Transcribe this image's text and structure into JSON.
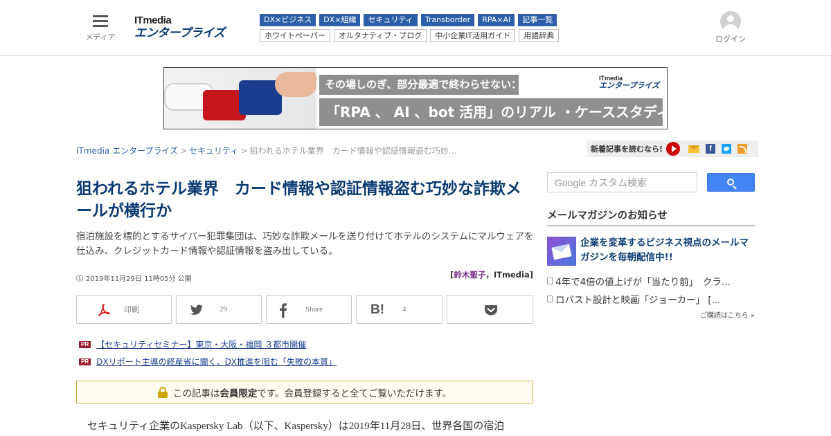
{
  "header": {
    "menu_label": "メディア",
    "logo_it": "ITmedia",
    "logo_name": "エンタープライズ",
    "tags_primary": [
      "DX×ビジネス",
      "DX×組織",
      "セキュリティ",
      "Transborder",
      "RPA×AI",
      "記事一覧"
    ],
    "tags_secondary": [
      "ホワイトペーパー",
      "オルタナティブ・ブログ",
      "中小企業IT活用ガイド",
      "用語辞典"
    ],
    "login_label": "ログイン"
  },
  "banner": {
    "line1": "その場しのぎ、部分最適で終わらせない：",
    "line2": "「RPA 、 AI 、bot 活用」のリアル ・ケーススタディー",
    "logo_it": "ITmedia",
    "logo_name": "エンタープライズ"
  },
  "breadcrumb": {
    "items": [
      "ITmedia エンタープライズ",
      "セキュリティ"
    ],
    "separator": ">",
    "current": "狙われるホテル業界　カード情報や認証情報盗む巧妙..."
  },
  "subscribe": {
    "label": "新着記事を読むなら!",
    "fb": "f"
  },
  "article": {
    "title": "狙われるホテル業界　カード情報や認証情報盗む巧妙な詐欺メールが横行か",
    "lead": "宿泊施設を標的とするサイバー犯罪集団は、巧妙な詐欺メールを送り付けてホテルのシステムにマルウェアを仕込み、クレジットカード情報や認証情報を盗み出している。",
    "date": "2019年11月29日 11時05分 公開",
    "author_open": "[",
    "author_name": "鈴木聖子",
    "author_sep": "，",
    "author_org": "ITmedia",
    "author_close": "]",
    "share": {
      "print_label": "印刷",
      "twitter_count": "29",
      "facebook_label": "Share",
      "hatena_label": "B!",
      "hatena_count": "4"
    },
    "pr_badge": "PR",
    "pr_links": [
      "【セキュリティセミナー】東京・大阪・福岡 ３都市開催",
      "DXリポート主導の経産省に聞く、DX推進を阻む「失敗の本質」"
    ],
    "members_prefix": "この記事は",
    "members_bold": "会員限定",
    "members_suffix": "です。会員登録すると全てご覧いただけます。",
    "body_first_line": "セキュリティ企業のKaspersky Lab（以下、Kaspersky）は2019年11月28日、世界各国の宿泊"
  },
  "sidebar": {
    "search_placeholder": "Google カスタム検索",
    "mailmag_heading": "メールマガジンのお知らせ",
    "mailmag_title": "企業を変革するビジネス視点のメールマガジンを毎朝配信中!!",
    "mailmag_items": [
      "4年で4倍の値上げが「当たり前」　クラ...",
      "ロバスト設計と映画「ジョーカー」 [..."
    ],
    "mailmag_more": "ご購読はこちら »"
  },
  "colors": {
    "title": "#0a3a72",
    "tag_blue": "#2d5fa8",
    "pr_badge": "#9b1b2f",
    "search_button": "#4285f4"
  }
}
